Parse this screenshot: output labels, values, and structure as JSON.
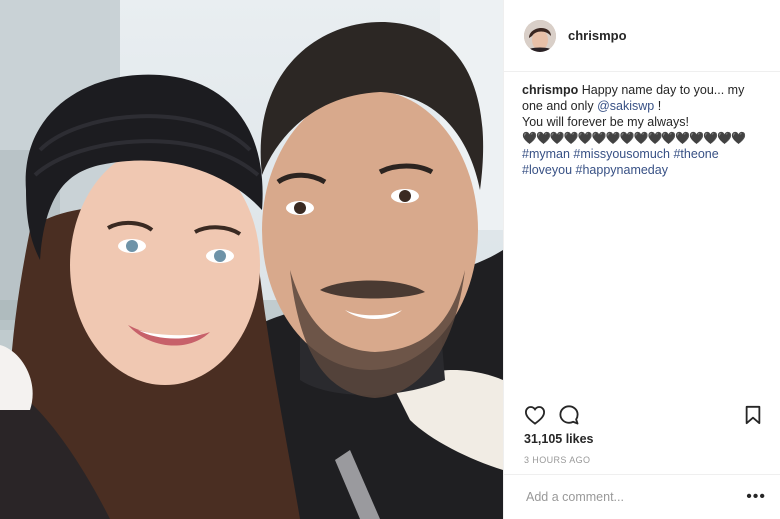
{
  "header": {
    "username": "chrismpo"
  },
  "caption": {
    "username": "chrismpo",
    "text_before_mention": "Happy name day to you... my one and only",
    "mention": "@sakiswp",
    "text_after_mention": "!",
    "line2": "You will forever be my always!",
    "hearts": "🖤🖤🖤🖤🖤🖤🖤🖤🖤🖤🖤🖤🖤🖤🖤🖤",
    "hashtags": [
      "#myman",
      "#missyousomuch",
      "#theone",
      "#loveyou",
      "#happynameday"
    ]
  },
  "actions": {
    "like_icon": "heart-outline-icon",
    "comment_icon": "comment-bubble-icon",
    "save_icon": "bookmark-icon"
  },
  "likes": "31,105 likes",
  "time_ago": "3 HOURS AGO",
  "comment": {
    "placeholder": "Add a comment...",
    "more": "•••"
  }
}
